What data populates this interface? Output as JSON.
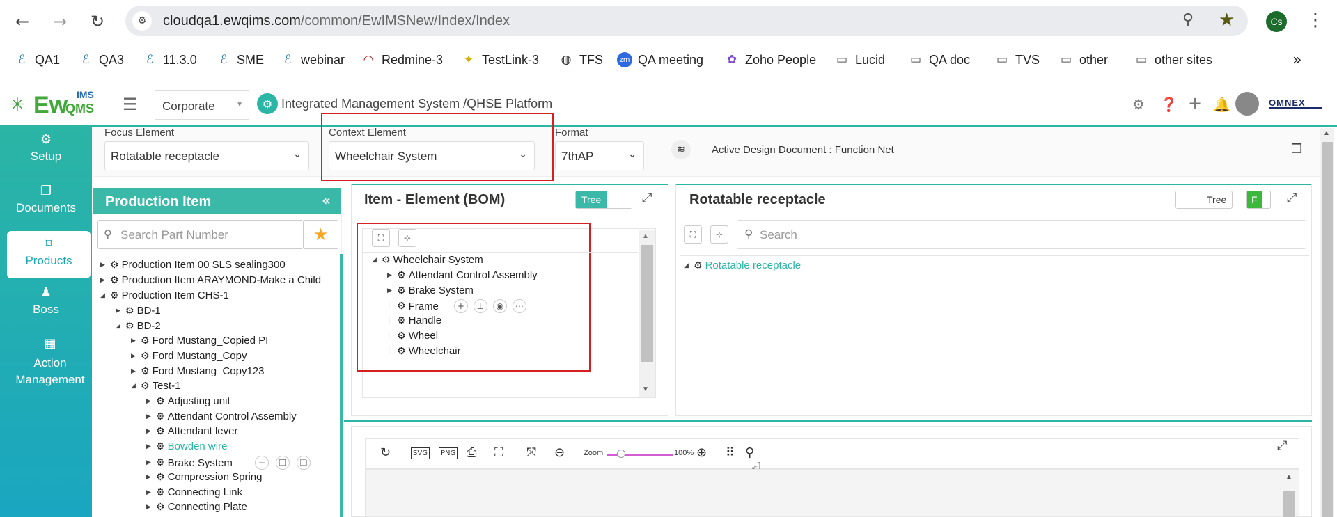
{
  "browser": {
    "url_host": "cloudqa1.ewqims.com",
    "url_path": "/common/EwIMSNew/Index/Index",
    "profile_initials": "Cs"
  },
  "bookmarks": [
    {
      "label": "QA1",
      "icon": "ewqims-icon"
    },
    {
      "label": "QA3",
      "icon": "ewqims-icon"
    },
    {
      "label": "11.3.0",
      "icon": "ewqims-icon"
    },
    {
      "label": "SME",
      "icon": "ewqims-icon"
    },
    {
      "label": "webinar",
      "icon": "ewqims-icon"
    },
    {
      "label": "Redmine-3",
      "icon": "redmine-icon"
    },
    {
      "label": "TestLink-3",
      "icon": "testlink-icon"
    },
    {
      "label": "TFS",
      "icon": "globe-icon"
    },
    {
      "label": "QA meeting",
      "icon": "zoom-icon"
    },
    {
      "label": "Zoho People",
      "icon": "zoho-icon"
    },
    {
      "label": "Lucid",
      "icon": "folder-icon"
    },
    {
      "label": "QA doc",
      "icon": "folder-icon"
    },
    {
      "label": "TVS",
      "icon": "folder-icon"
    },
    {
      "label": "other",
      "icon": "folder-icon"
    },
    {
      "label": "other sites",
      "icon": "folder-icon"
    }
  ],
  "app": {
    "logo_main": "Ew",
    "logo_ims": "IMS",
    "logo_qms": "QMS",
    "site_select": "Corporate",
    "title": "Integrated Management System /QHSE Platform",
    "brand": "OMNEX"
  },
  "nav": [
    {
      "label": "Setup"
    },
    {
      "label": "Documents"
    },
    {
      "label": "Products"
    },
    {
      "label": "Boss"
    },
    {
      "label": "Action Management"
    }
  ],
  "filters": {
    "focus_label": "Focus Element",
    "focus_value": "Rotatable receptacle",
    "context_label": "Context Element",
    "context_value": "Wheelchair System",
    "format_label": "Format",
    "format_value": "7thAP",
    "active_doc": "Active Design Document : Function Net"
  },
  "production": {
    "title": "Production Item",
    "search_placeholder": "Search Part Number",
    "items": [
      {
        "label": "Production Item 00 SLS sealing300"
      },
      {
        "label": "Production Item ARAYMOND-Make a Child"
      },
      {
        "label": "Production Item CHS-1"
      },
      {
        "label": "BD-1"
      },
      {
        "label": "BD-2"
      },
      {
        "label": "Ford Mustang_Copied PI"
      },
      {
        "label": "Ford Mustang_Copy"
      },
      {
        "label": "Ford Mustang_Copy123"
      },
      {
        "label": "Test-1"
      },
      {
        "label": "Adjusting unit"
      },
      {
        "label": "Attendant Control Assembly"
      },
      {
        "label": "Attendant lever"
      },
      {
        "label": "Bowden wire"
      },
      {
        "label": "Brake System"
      },
      {
        "label": "Compression Spring"
      },
      {
        "label": "Connecting Link"
      },
      {
        "label": "Connecting Plate"
      }
    ]
  },
  "bom": {
    "title": "Item - Element (BOM)",
    "toggle_label": "Tree",
    "items": [
      {
        "label": "Wheelchair System"
      },
      {
        "label": "Attendant Control Assembly"
      },
      {
        "label": "Brake System"
      },
      {
        "label": "Frame"
      },
      {
        "label": "Handle"
      },
      {
        "label": "Wheel"
      },
      {
        "label": "Wheelchair"
      }
    ]
  },
  "rotatable": {
    "title": "Rotatable receptacle",
    "toggle_label": "Tree",
    "f_label": "F",
    "search_placeholder": "Search",
    "root": "Rotatable receptacle"
  },
  "diagram_toolbar": {
    "svg_label": "SVG",
    "png_label": "PNG",
    "zoom_label": "Zoom",
    "zoom_value": "100%"
  },
  "colors": {
    "accent": "#2bb5a5",
    "highlight_box": "#d42020",
    "zoom_slider": "#d35dd3"
  }
}
